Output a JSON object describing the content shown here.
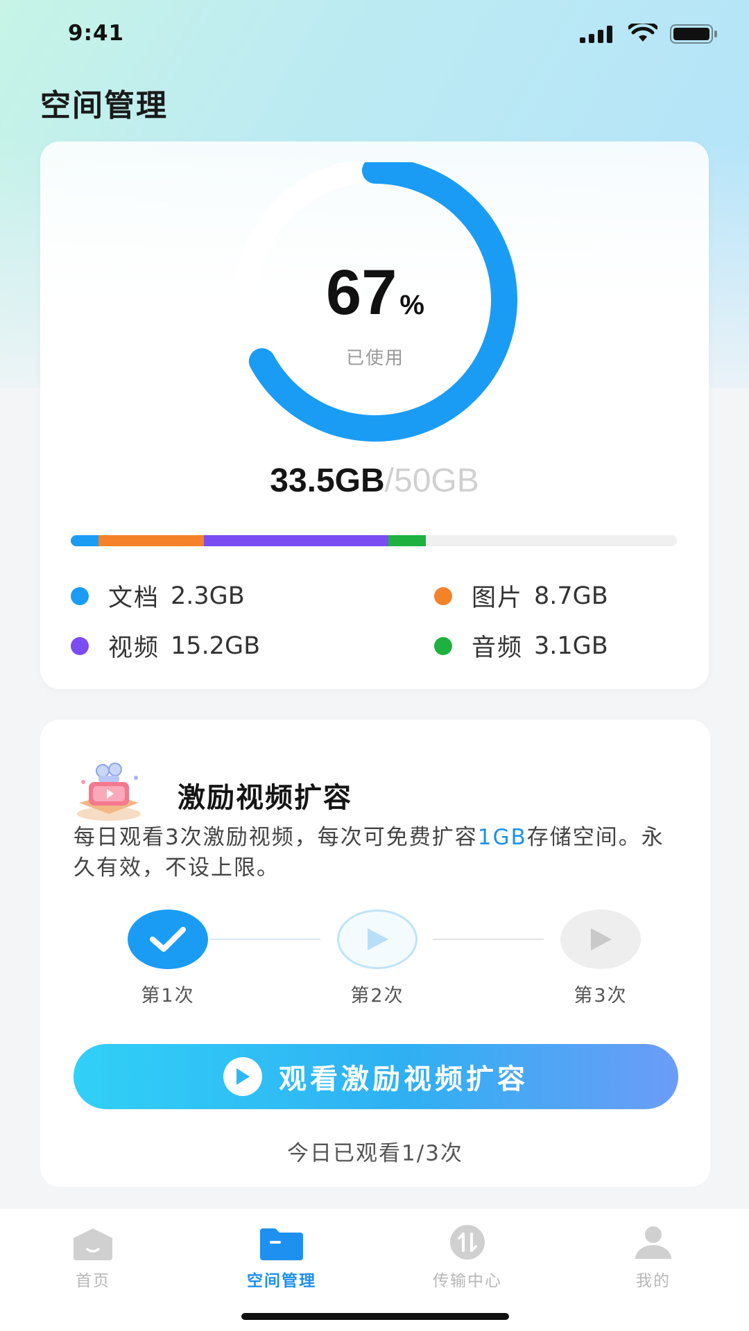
{
  "status": {
    "time": "9:41"
  },
  "page": {
    "title": "空间管理"
  },
  "storage": {
    "percent": "67",
    "percent_unit": "%",
    "percent_value": 67,
    "used_caption": "已使用",
    "used": "33.5GB",
    "total": "/50GB",
    "categories": [
      {
        "name": "文档",
        "size": "2.3GB",
        "gb": 2.3,
        "color": "#1a9cf5"
      },
      {
        "name": "图片",
        "size": "8.7GB",
        "gb": 8.7,
        "color": "#f58228"
      },
      {
        "name": "视频",
        "size": "15.2GB",
        "gb": 15.2,
        "color": "#7a4cf2"
      },
      {
        "name": "音频",
        "size": "3.1GB",
        "gb": 3.1,
        "color": "#1fb140"
      }
    ],
    "total_gb": 50,
    "ring_color": "#1a9cf5"
  },
  "reward": {
    "title": "激励视频扩容",
    "desc_before": "每日观看3次激励视频，每次可免费扩容",
    "desc_highlight": "1GB",
    "desc_after": "存储空间。永久有效，不设上限。",
    "steps": [
      {
        "label": "第1次",
        "state": "done"
      },
      {
        "label": "第2次",
        "state": "current"
      },
      {
        "label": "第3次",
        "state": "locked"
      }
    ],
    "button_label": "观看激励视频扩容",
    "watched_text": "今日已观看1/3次"
  },
  "tabs": [
    {
      "label": "首页",
      "icon": "home-icon",
      "active": false
    },
    {
      "label": "空间管理",
      "icon": "folder-icon",
      "active": true
    },
    {
      "label": "传输中心",
      "icon": "transfer-icon",
      "active": false
    },
    {
      "label": "我的",
      "icon": "user-icon",
      "active": false
    }
  ],
  "colors": {
    "accent": "#1e90f0",
    "inactive": "#c2c2c2"
  }
}
